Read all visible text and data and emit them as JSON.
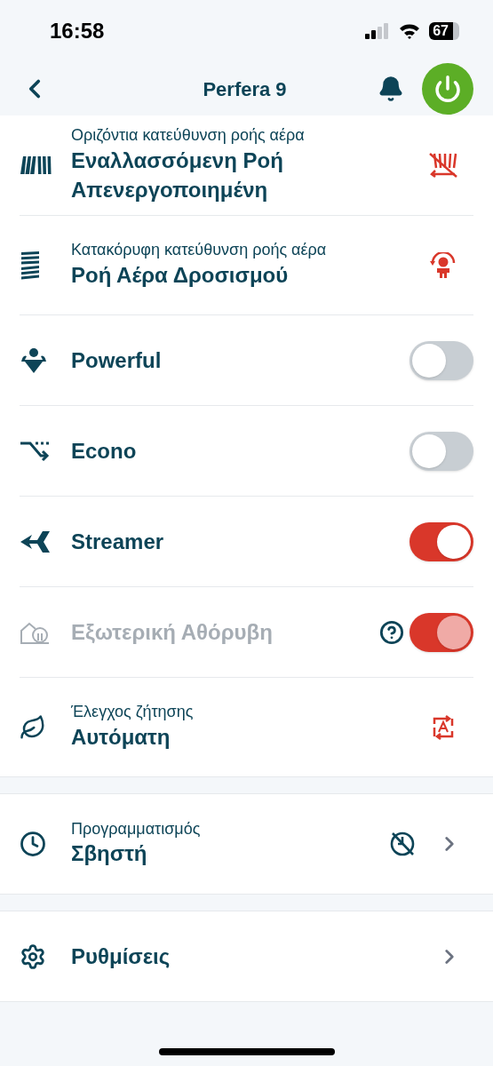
{
  "status_bar": {
    "time": "16:58",
    "battery": "67"
  },
  "header": {
    "title": "Perfera 9",
    "power_on": true
  },
  "sections": [
    {
      "rows": [
        {
          "kind": "value",
          "label": "Οριζόντια κατεύθυνση ροής αέρα",
          "value": "Εναλλασσόμενη Ροή Απενεργοποιημένη"
        },
        {
          "kind": "value",
          "label": "Κατακόρυφη κατεύθυνση ροής αέρα",
          "value": "Ροή Αέρα Δροσισμού"
        },
        {
          "kind": "toggle",
          "label": "Powerful",
          "on": false,
          "disabled": false,
          "help": false
        },
        {
          "kind": "toggle",
          "label": "Econo",
          "on": false,
          "disabled": false,
          "help": false
        },
        {
          "kind": "toggle",
          "label": "Streamer",
          "on": true,
          "disabled": false,
          "help": false
        },
        {
          "kind": "toggle",
          "label": "Εξωτερική Αθόρυβη",
          "on": true,
          "disabled": true,
          "help": true
        },
        {
          "kind": "value",
          "label": "Έλεγχος ζήτησης",
          "value": "Αυτόματη"
        }
      ]
    },
    {
      "rows": [
        {
          "kind": "link",
          "label": "Προγραμματισμός",
          "value": "Σβηστή"
        }
      ]
    },
    {
      "rows": [
        {
          "kind": "link",
          "label": "Ρυθμίσεις"
        }
      ]
    }
  ]
}
